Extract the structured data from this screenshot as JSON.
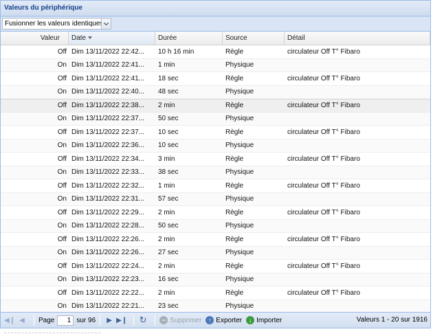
{
  "panel": {
    "title": "Valeurs du périphérique"
  },
  "toolbar": {
    "merge_combo_value": "Fusionner les valeurs identiques"
  },
  "columns": {
    "value": "Valeur",
    "date": "Date",
    "duration": "Durée",
    "source": "Source",
    "detail": "Détail"
  },
  "rows": [
    {
      "value": "Off",
      "date": "Dim 13/11/2022 22:42...",
      "duration": "10 h 16 min",
      "source": "Règle",
      "detail": "circulateur Off T° Fibaro"
    },
    {
      "value": "On",
      "date": "Dim 13/11/2022 22:41...",
      "duration": "1 min",
      "source": "Physique",
      "detail": ""
    },
    {
      "value": "Off",
      "date": "Dim 13/11/2022 22:41...",
      "duration": "18 sec",
      "source": "Règle",
      "detail": "circulateur Off T° Fibaro"
    },
    {
      "value": "On",
      "date": "Dim 13/11/2022 22:40...",
      "duration": "48 sec",
      "source": "Physique",
      "detail": ""
    },
    {
      "value": "Off",
      "date": "Dim 13/11/2022 22:38...",
      "duration": "2 min",
      "source": "Règle",
      "detail": "circulateur Off T° Fibaro"
    },
    {
      "value": "On",
      "date": "Dim 13/11/2022 22:37...",
      "duration": "50 sec",
      "source": "Physique",
      "detail": ""
    },
    {
      "value": "Off",
      "date": "Dim 13/11/2022 22:37...",
      "duration": "10 sec",
      "source": "Règle",
      "detail": "circulateur Off T° Fibaro"
    },
    {
      "value": "On",
      "date": "Dim 13/11/2022 22:36...",
      "duration": "10 sec",
      "source": "Physique",
      "detail": ""
    },
    {
      "value": "Off",
      "date": "Dim 13/11/2022 22:34...",
      "duration": "3 min",
      "source": "Règle",
      "detail": "circulateur Off T° Fibaro"
    },
    {
      "value": "On",
      "date": "Dim 13/11/2022 22:33...",
      "duration": "38 sec",
      "source": "Physique",
      "detail": ""
    },
    {
      "value": "Off",
      "date": "Dim 13/11/2022 22:32...",
      "duration": "1 min",
      "source": "Règle",
      "detail": "circulateur Off T° Fibaro"
    },
    {
      "value": "On",
      "date": "Dim 13/11/2022 22:31...",
      "duration": "57 sec",
      "source": "Physique",
      "detail": ""
    },
    {
      "value": "Off",
      "date": "Dim 13/11/2022 22:29...",
      "duration": "2 min",
      "source": "Règle",
      "detail": "circulateur Off T° Fibaro"
    },
    {
      "value": "On",
      "date": "Dim 13/11/2022 22:28...",
      "duration": "50 sec",
      "source": "Physique",
      "detail": ""
    },
    {
      "value": "Off",
      "date": "Dim 13/11/2022 22:26...",
      "duration": "2 min",
      "source": "Règle",
      "detail": "circulateur Off T° Fibaro"
    },
    {
      "value": "On",
      "date": "Dim 13/11/2022 22:26...",
      "duration": "27 sec",
      "source": "Physique",
      "detail": ""
    },
    {
      "value": "Off",
      "date": "Dim 13/11/2022 22:24...",
      "duration": "2 min",
      "source": "Règle",
      "detail": "circulateur Off T° Fibaro"
    },
    {
      "value": "On",
      "date": "Dim 13/11/2022 22:23...",
      "duration": "16 sec",
      "source": "Physique",
      "detail": ""
    },
    {
      "value": "Off",
      "date": "Dim 13/11/2022 22:22...",
      "duration": "2 min",
      "source": "Règle",
      "detail": "circulateur Off T° Fibaro"
    },
    {
      "value": "On",
      "date": "Dim 13/11/2022 22:21...",
      "duration": "23 sec",
      "source": "Physique",
      "detail": ""
    }
  ],
  "pager": {
    "page_label": "Page",
    "page_value": "1",
    "of_label": "sur 96",
    "delete_label": "Supprimer",
    "export_label": "Exporter",
    "import_label": "Importer",
    "summary": "Valeurs 1 - 20 sur 1916"
  },
  "icons": {
    "first": "first-page-icon",
    "prev": "prev-page-icon",
    "next": "next-page-icon",
    "last": "last-page-icon",
    "refresh": "refresh-icon",
    "delete": "delete-icon",
    "export": "export-cloud-icon",
    "import": "import-cloud-icon"
  },
  "colors": {
    "title_text": "#15428b",
    "panel_border": "#99bbe8",
    "header_bg": "#dfe8f6",
    "delete_icon": "#9aa3ad",
    "export_icon": "#4a78b5",
    "import_icon": "#3c9a3c"
  }
}
